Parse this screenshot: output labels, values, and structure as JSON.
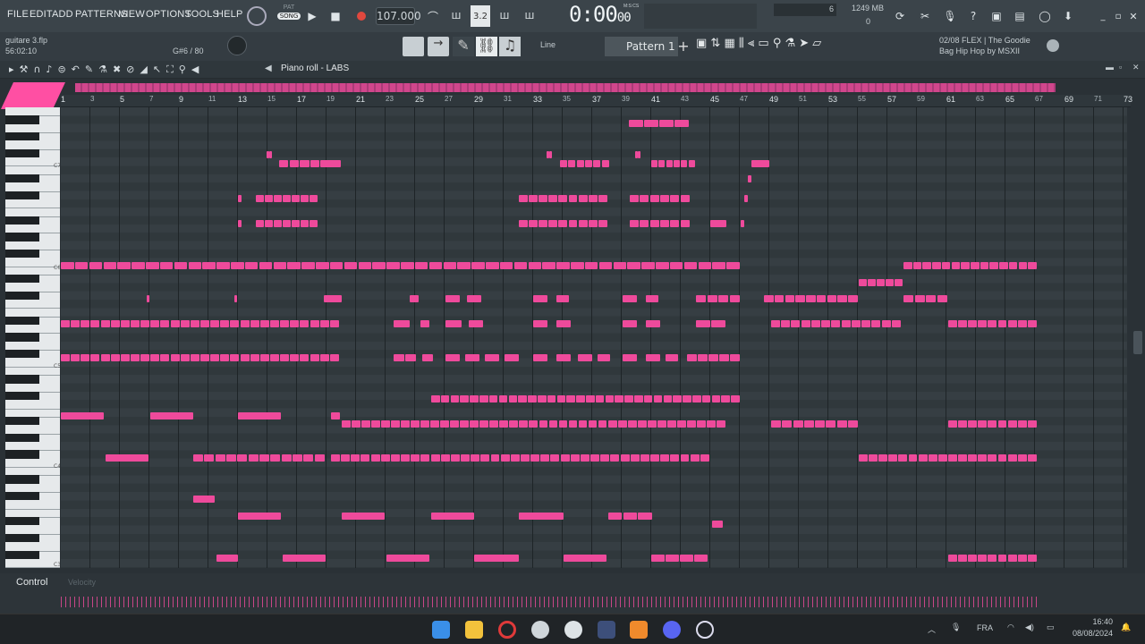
{
  "menu": [
    "FILE",
    "EDIT",
    "ADD",
    "PATTERNS",
    "VIEW",
    "OPTIONS",
    "TOOLS",
    "HELP"
  ],
  "transport": {
    "pat": "PAT",
    "song": "SONG",
    "tempo": "107.000",
    "time": "0:00",
    "time_small": "00",
    "time_label": "M:S:CS",
    "step": "3.2"
  },
  "meters": {
    "cpu": "6",
    "mem": "1249 MB",
    "voices": "0"
  },
  "project": {
    "file": "guitare 3.flp",
    "position": "56:02:10",
    "note_info": "G#6 / 80"
  },
  "toolbar2": {
    "mode": "Line",
    "pattern": "Pattern 1"
  },
  "news": {
    "count": "02/08",
    "line1": "FLEX | The Goodie",
    "line2": "Bag Hip Hop by MSXII"
  },
  "pianoroll": {
    "title": "Piano roll - LABS"
  },
  "ruler": [
    1,
    3,
    5,
    7,
    9,
    11,
    13,
    15,
    17,
    19,
    21,
    23,
    25,
    27,
    29,
    31,
    33,
    35,
    37,
    39,
    41,
    43,
    45,
    47,
    49,
    51,
    53,
    55,
    57,
    59,
    61,
    63,
    65,
    67,
    69,
    71,
    73
  ],
  "octaves": [
    "C7",
    "C6",
    "C5",
    "C4",
    "C3"
  ],
  "control": {
    "label": "Control",
    "param": "Velocity"
  },
  "taskbar": {
    "lang": "FRA",
    "clock": "16:40",
    "date": "08/08/2024"
  },
  "colors": {
    "note": "#ee4a9b",
    "accent": "#ff4fa3"
  }
}
